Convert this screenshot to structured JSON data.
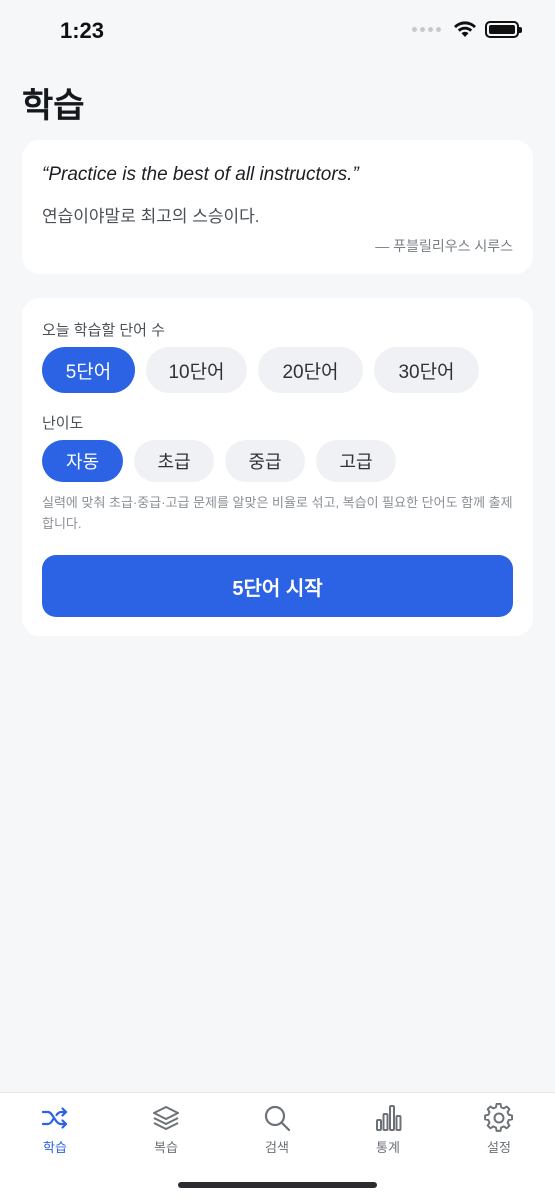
{
  "status_bar": {
    "time": "1:23"
  },
  "page": {
    "title": "학습"
  },
  "quote": {
    "english": "“Practice is the best of all instructors.”",
    "korean": "연습이야말로 최고의 스승이다.",
    "author": "— 푸블릴리우스 시루스"
  },
  "settings": {
    "word_count_label": "오늘 학습할 단어 수",
    "word_count_options": [
      "5단어",
      "10단어",
      "20단어",
      "30단어"
    ],
    "word_count_selected": "5단어",
    "difficulty_label": "난이도",
    "difficulty_options": [
      "자동",
      "초급",
      "중급",
      "고급"
    ],
    "difficulty_selected": "자동",
    "description": "실력에 맞춰 초급·중급·고급 문제를 알맞은 비율로 섞고, 복습이 필요한 단어도 함께 출제합니다.",
    "start_button": "5단어 시작"
  },
  "tab_bar": {
    "tabs": [
      {
        "label": "학습",
        "icon": "shuffle-icon",
        "active": true
      },
      {
        "label": "복습",
        "icon": "layers-icon",
        "active": false
      },
      {
        "label": "검색",
        "icon": "search-icon",
        "active": false
      },
      {
        "label": "통계",
        "icon": "bar-chart-icon",
        "active": false
      },
      {
        "label": "설정",
        "icon": "gear-icon",
        "active": false
      }
    ]
  },
  "colors": {
    "accent": "#2b63e4",
    "background": "#f6f7f9",
    "chip": "#f0f1f4"
  }
}
